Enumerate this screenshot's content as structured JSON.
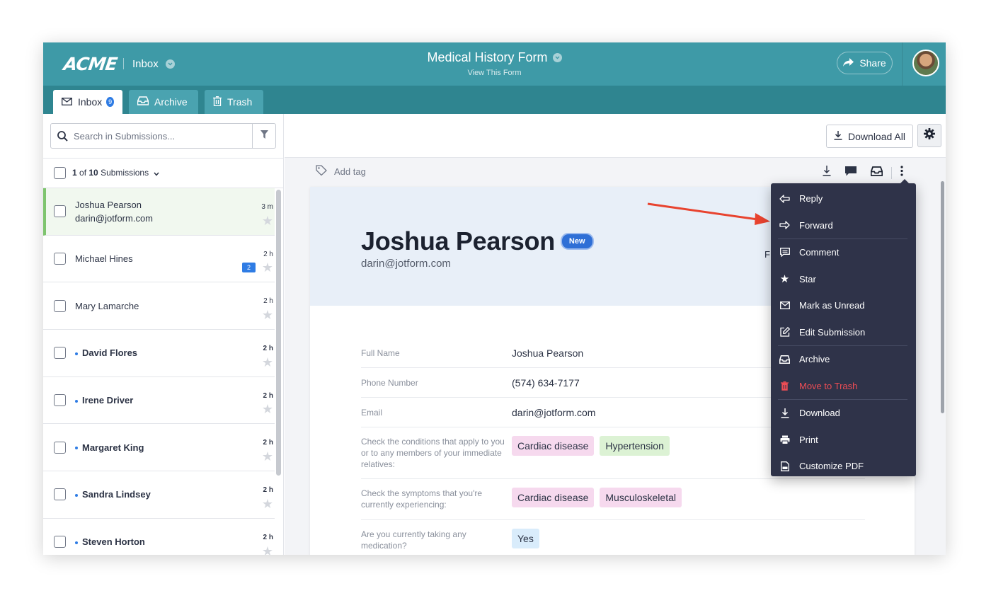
{
  "header": {
    "logo": "ACME",
    "inbox_label": "Inbox",
    "form_title": "Medical History Form",
    "view_form": "View This Form",
    "share_label": "Share"
  },
  "tabs": [
    {
      "label": "Inbox",
      "badge": "9"
    },
    {
      "label": "Archive"
    },
    {
      "label": "Trash"
    }
  ],
  "search": {
    "placeholder": "Search in Submissions..."
  },
  "submissions_count": {
    "current": "1",
    "of_text": " of ",
    "total": "10",
    "suffix": " Submissions"
  },
  "submissions": [
    {
      "name": "Joshua Pearson",
      "email": "darin@jotform.com",
      "time": "3 m",
      "unread": false
    },
    {
      "name": "Michael Hines",
      "time": "2 h",
      "comments": "2",
      "unread": false
    },
    {
      "name": "Mary Lamarche",
      "time": "2 h",
      "unread": false
    },
    {
      "name": "David Flores",
      "time": "2 h",
      "unread": true
    },
    {
      "name": "Irene Driver",
      "time": "2 h",
      "unread": true
    },
    {
      "name": "Margaret King",
      "time": "2 h",
      "unread": true
    },
    {
      "name": "Sandra Lindsey",
      "time": "2 h",
      "unread": true
    },
    {
      "name": "Steven Horton",
      "time": "2 h",
      "unread": true
    }
  ],
  "toolbar": {
    "download_all": "Download All"
  },
  "detail": {
    "add_tag": "Add tag",
    "name": "Joshua Pearson",
    "new_badge": "New",
    "email": "darin@jotform.com",
    "partial_text": "F",
    "fields": [
      {
        "label": "Full Name",
        "value": "Joshua Pearson"
      },
      {
        "label": "Phone Number",
        "value": "(574) 634-7177"
      },
      {
        "label": "Email",
        "value": "darin@jotform.com"
      },
      {
        "label": "Check the conditions that apply to you or to any members of your immediate relatives:",
        "chips": [
          "Cardiac disease",
          "Hypertension"
        ]
      },
      {
        "label": "Check the symptoms that you're currently experiencing:",
        "chips": [
          "Cardiac disease",
          "Musculoskeletal"
        ]
      },
      {
        "label": "Are you currently taking any medication?",
        "chips": [
          "Yes"
        ]
      }
    ]
  },
  "menu": {
    "items": [
      "Reply",
      "Forward",
      "Comment",
      "Star",
      "Mark as Unread",
      "Edit Submission",
      "Archive",
      "Move to Trash",
      "Download",
      "Print",
      "Customize PDF"
    ]
  },
  "colors": {
    "header": "#3e9aa7",
    "tabbar": "#2f8590",
    "menu_bg": "#2f3349",
    "danger": "#ee4d55",
    "annotation_arrow": "#e8432f"
  },
  "icons": [
    "chevron-down-icon",
    "share-icon",
    "mail-icon",
    "archive-icon",
    "trash-icon",
    "search-icon",
    "filter-icon",
    "star-icon",
    "tag-icon",
    "download-icon",
    "comment-icon",
    "more-vertical-icon",
    "gear-icon",
    "reply-icon",
    "forward-icon",
    "edit-icon",
    "print-icon",
    "pdf-icon"
  ]
}
